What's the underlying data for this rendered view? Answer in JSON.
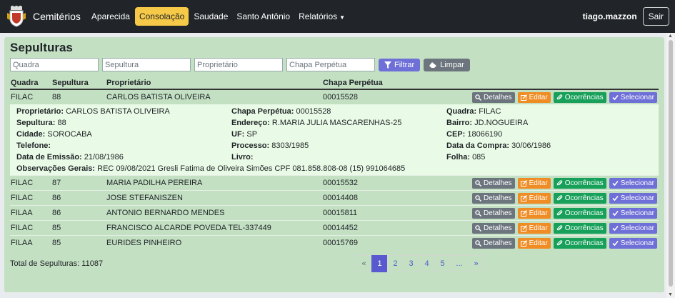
{
  "navbar": {
    "brand": "Cemitérios",
    "links": [
      "Aparecida",
      "Consolação",
      "Saudade",
      "Santo Antônio",
      "Relatórios"
    ],
    "user": "tiago.mazzon",
    "logout": "Sair"
  },
  "page": {
    "title": "Sepulturas"
  },
  "filters": {
    "quadra_placeholder": "Quadra",
    "sepultura_placeholder": "Sepultura",
    "proprietario_placeholder": "Proprietário",
    "chapa_placeholder": "Chapa Perpétua",
    "filtrar_label": "Filtrar",
    "limpar_label": "Limpar"
  },
  "table": {
    "headers": [
      "Quadra",
      "Sepultura",
      "Proprietário",
      "Chapa Perpétua"
    ],
    "rows": [
      [
        "FILAC",
        "88",
        "CARLOS BATISTA OLIVEIRA",
        "00015528"
      ],
      [
        "FILAC",
        "87",
        "MARIA PADILHA PEREIRA",
        "00015532"
      ],
      [
        "FILAC",
        "86",
        "JOSE STEFANISZEN",
        "00014408"
      ],
      [
        "FILAA",
        "86",
        "ANTONIO BERNARDO MENDES",
        "00015811"
      ],
      [
        "FILAC",
        "85",
        "FRANCISCO ALCARDE POVEDA TEL-337449",
        "00014452"
      ],
      [
        "FILAA",
        "85",
        "EURIDES PINHEIRO",
        "00015769"
      ]
    ],
    "actions": {
      "detalhes": "Detalhes",
      "editar": "Editar",
      "ocorrencias": "Ocorrências",
      "selecionar": "Selecionar"
    }
  },
  "detail": {
    "proprietario_label": "Proprietário:",
    "proprietario": "CARLOS BATISTA OLIVEIRA",
    "chapa_label": "Chapa Perpétua:",
    "chapa": "00015528",
    "quadra_label": "Quadra:",
    "quadra": "FILAC",
    "sepultura_label": "Sepultura:",
    "sepultura": "88",
    "endereco_label": "Endereço:",
    "endereco": "R.MARIA JULIA MASCARENHAS-25",
    "bairro_label": "Bairro:",
    "bairro": "JD.NOGUEIRA",
    "cidade_label": "Cidade:",
    "cidade": "SOROCABA",
    "uf_label": "UF:",
    "uf": "SP",
    "cep_label": "CEP:",
    "cep": "18066190",
    "telefone_label": "Telefone:",
    "telefone": "",
    "processo_label": "Processo:",
    "processo": "8303/1985",
    "data_compra_label": "Data da Compra:",
    "data_compra": "30/06/1986",
    "data_emissao_label": "Data de Emissão:",
    "data_emissao": "21/08/1986",
    "livro_label": "Livro:",
    "livro": "",
    "folha_label": "Folha:",
    "folha": "085",
    "obs_label": "Observações Gerais:",
    "obs": "REC 09/08/2021 Gresli Fatima de Oliveira Simões CPF 081.858.808-08 (15) 991064685"
  },
  "footer": {
    "total": "Total de Sepulturas: 11087",
    "pages": [
      "«",
      "1",
      "2",
      "3",
      "4",
      "5",
      "...",
      "»"
    ],
    "active_page": "1"
  }
}
